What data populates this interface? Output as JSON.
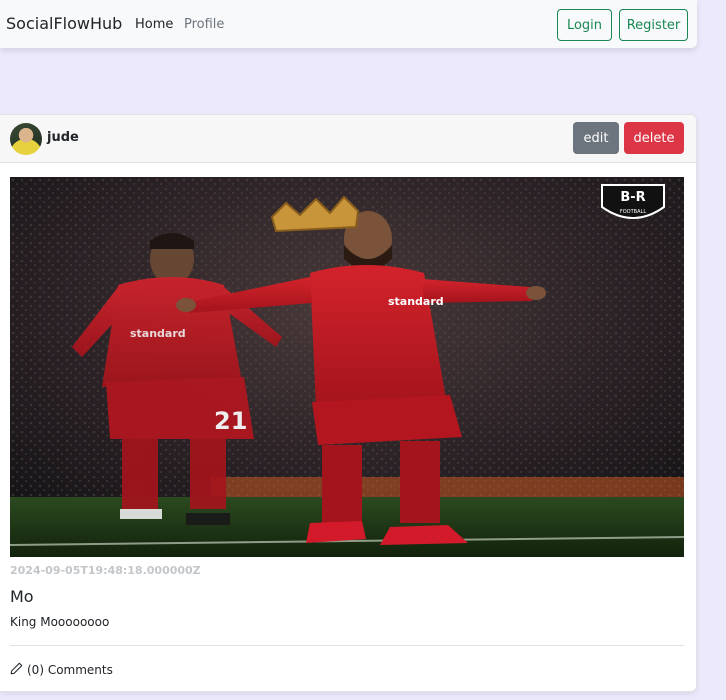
{
  "navbar": {
    "brand": "SocialFlowHub",
    "links": [
      "Home",
      "Profile"
    ],
    "login_label": "Login",
    "register_label": "Register",
    "accent_color": "#198754"
  },
  "post": {
    "author": "jude",
    "edit_label": "edit",
    "delete_label": "delete",
    "image": {
      "description_icon": "soccer-photo",
      "badge_text": "B-R",
      "badge_sub": "FOOTBALL",
      "player_number_left": "21"
    },
    "timestamp": "2024-09-05T19:48:18.000000Z",
    "title": "Mo",
    "body": "King Moooooooo",
    "comments_label": "(0) Comments",
    "comments_icon": "pen-icon"
  },
  "colors": {
    "edit": "#6c757d",
    "delete": "#dc3545",
    "background": "#ede9fc"
  }
}
